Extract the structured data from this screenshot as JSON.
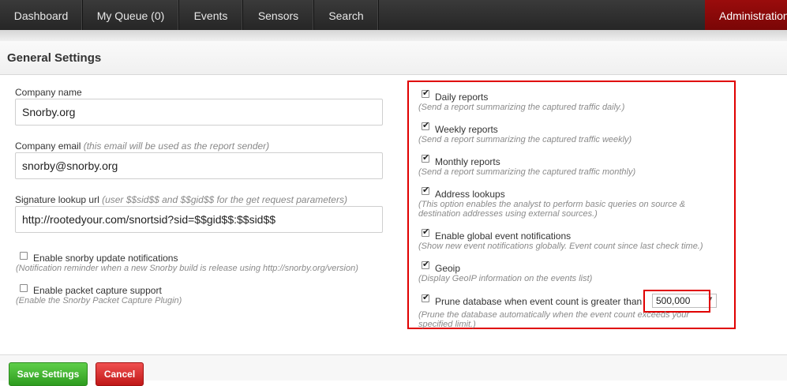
{
  "nav": {
    "items": [
      "Dashboard",
      "My Queue (0)",
      "Events",
      "Sensors",
      "Search"
    ],
    "admin": "Administration"
  },
  "header": {
    "title": "General Settings"
  },
  "form": {
    "company_name": {
      "label": "Company name",
      "value": "Snorby.org"
    },
    "company_email": {
      "label": "Company email",
      "hint": "(this email will be used as the report sender)",
      "value": "snorby@snorby.org"
    },
    "signature_url": {
      "label": "Signature lookup url",
      "hint": "(user $$sid$$ and $$gid$$ for the get request parameters)",
      "value": "http://rootedyour.com/snortsid?sid=$$gid$$:$$sid$$"
    },
    "update_notifications": {
      "label": "Enable snorby update notifications",
      "desc": "(Notification reminder when a new Snorby build is release using http://snorby.org/version)",
      "checked": false
    },
    "packet_capture": {
      "label": "Enable packet capture support",
      "desc": "(Enable the Snorby Packet Capture Plugin)",
      "checked": false
    }
  },
  "options": {
    "daily": {
      "label": "Daily reports",
      "desc": "(Send a report summarizing the captured traffic daily.)",
      "checked": true
    },
    "weekly": {
      "label": "Weekly reports",
      "desc": "(Send a report summarizing the captured traffic weekly)",
      "checked": true
    },
    "monthly": {
      "label": "Monthly reports",
      "desc": "(Send a report summarizing the captured traffic monthly)",
      "checked": true
    },
    "address": {
      "label": "Address lookups",
      "desc1": "(This option enables the analyst to perform basic queries on source &",
      "desc2": "destination addresses using external sources.)",
      "checked": true
    },
    "global": {
      "label": "Enable global event notifications",
      "desc": "(Show new event notifications globally. Event count since last check time.)",
      "checked": true
    },
    "geoip": {
      "label": "Geoip",
      "desc": "(Display GeoIP information on the events list)",
      "checked": true
    },
    "prune": {
      "label": "Prune database when event count is greater than",
      "value": "500,000",
      "desc1": "(Prune the database automatically when the event count exceeds your",
      "desc2": "specified limit.)",
      "checked": true
    }
  },
  "buttons": {
    "save": "Save Settings",
    "cancel": "Cancel"
  },
  "colors": {
    "highlight": "#e00000",
    "save": "#3aab28",
    "cancel": "#d62626",
    "admin": "#8a0909"
  }
}
